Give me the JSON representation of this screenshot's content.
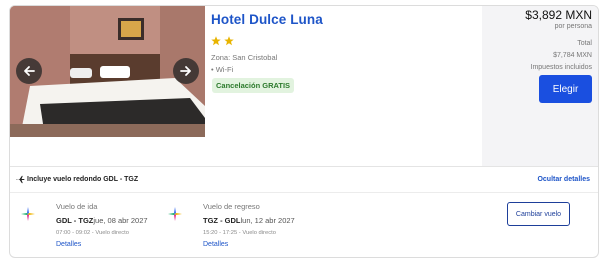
{
  "hotel": {
    "name": "Hotel Dulce Luna",
    "stars": 2,
    "zone": "Zona: San Cristobal",
    "amenity": "• Wi-Fi",
    "cancellation_badge": "Cancelación GRATIS",
    "photo_icon": "hotel-room-photo"
  },
  "price": {
    "main": "$3,892 MXN",
    "per_person": "por persona",
    "total_label": "Total",
    "total_value": "$7,784 MXN",
    "taxes": "Impuestos incluidos",
    "choose_label": "Elegir",
    "button_color": "#1a4fe0"
  },
  "flight": {
    "summary": "Incluye vuelo redondo GDL - TGZ",
    "hide_details": "Ocultar detalles",
    "change_label": "Cambiar vuelo",
    "legs": [
      {
        "title": "Vuelo de ida",
        "route": "GDL - TGZ",
        "date": "jue, 08 abr 2027",
        "times": "07:00 - 09:02 - Vuelo directo",
        "details": "Detalles"
      },
      {
        "title": "Vuelo de regreso",
        "route": "TGZ - GDL",
        "date": "lun, 12 abr 2027",
        "times": "15:20 - 17:25 - Vuelo directo",
        "details": "Detalles"
      }
    ]
  },
  "colors": {
    "link": "#1e55c8",
    "star": "#e8b400",
    "badge_bg": "#e2f3df",
    "badge_text": "#2c7a2c"
  }
}
